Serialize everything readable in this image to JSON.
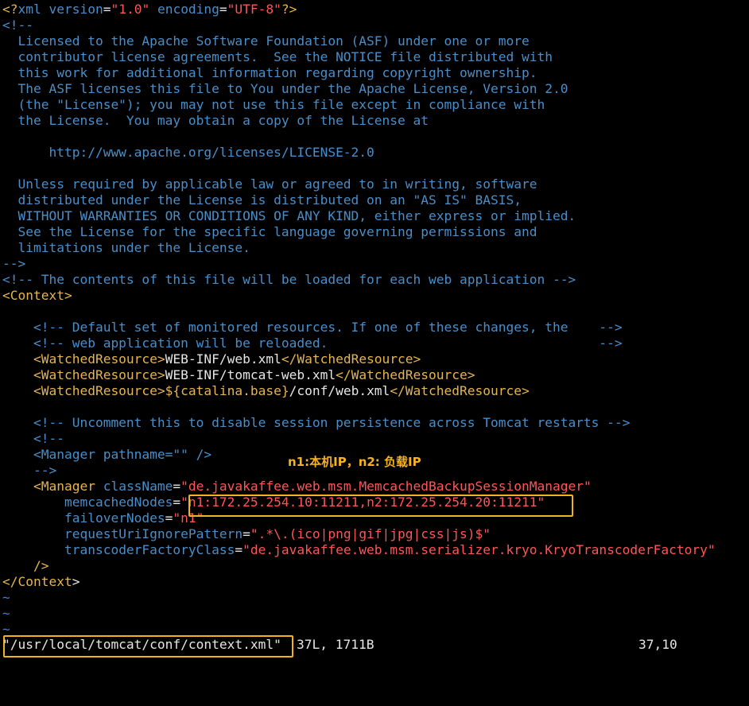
{
  "editor": {
    "lines": [
      {
        "segs": [
          [
            "tag",
            "<?"
          ],
          [
            "attr",
            "xml "
          ],
          [
            "attr",
            "version"
          ],
          [
            "text",
            "="
          ],
          [
            "str",
            "\"1.0\""
          ],
          [
            "text",
            " "
          ],
          [
            "attr",
            "encoding"
          ],
          [
            "text",
            "="
          ],
          [
            "str",
            "\"UTF-8\""
          ],
          [
            "tag",
            "?>"
          ]
        ]
      },
      {
        "segs": [
          [
            "comment",
            "<!--"
          ]
        ]
      },
      {
        "segs": [
          [
            "comment",
            "  Licensed to the Apache Software Foundation (ASF) under one or more"
          ]
        ]
      },
      {
        "segs": [
          [
            "comment",
            "  contributor license agreements.  See the NOTICE file distributed with"
          ]
        ]
      },
      {
        "segs": [
          [
            "comment",
            "  this work for additional information regarding copyright ownership."
          ]
        ]
      },
      {
        "segs": [
          [
            "comment",
            "  The ASF licenses this file to You under the Apache License, Version 2.0"
          ]
        ]
      },
      {
        "segs": [
          [
            "comment",
            "  (the \"License\"); you may not use this file except in compliance with"
          ]
        ]
      },
      {
        "segs": [
          [
            "comment",
            "  the License.  You may obtain a copy of the License at"
          ]
        ]
      },
      {
        "segs": [
          [
            "comment",
            ""
          ]
        ]
      },
      {
        "segs": [
          [
            "comment",
            "      http://www.apache.org/licenses/LICENSE-2.0"
          ]
        ]
      },
      {
        "segs": [
          [
            "comment",
            ""
          ]
        ]
      },
      {
        "segs": [
          [
            "comment",
            "  Unless required by applicable law or agreed to in writing, software"
          ]
        ]
      },
      {
        "segs": [
          [
            "comment",
            "  distributed under the License is distributed on an \"AS IS\" BASIS,"
          ]
        ]
      },
      {
        "segs": [
          [
            "comment",
            "  WITHOUT WARRANTIES OR CONDITIONS OF ANY KIND, either express or implied."
          ]
        ]
      },
      {
        "segs": [
          [
            "comment",
            "  See the License for the specific language governing permissions and"
          ]
        ]
      },
      {
        "segs": [
          [
            "comment",
            "  limitations under the License."
          ]
        ]
      },
      {
        "segs": [
          [
            "comment",
            "-->"
          ]
        ]
      },
      {
        "segs": [
          [
            "comment",
            "<!-- The contents of this file will be loaded for each web application -->"
          ]
        ]
      },
      {
        "segs": [
          [
            "tag",
            "<Context>"
          ]
        ]
      },
      {
        "segs": [
          [
            "text",
            ""
          ]
        ]
      },
      {
        "segs": [
          [
            "text",
            "    "
          ],
          [
            "comment",
            "<!-- Default set of monitored resources. If one of these changes, the    -->"
          ]
        ]
      },
      {
        "segs": [
          [
            "text",
            "    "
          ],
          [
            "comment",
            "<!-- web application will be reloaded.                                   -->"
          ]
        ]
      },
      {
        "segs": [
          [
            "text",
            "    "
          ],
          [
            "tag",
            "<WatchedResource>"
          ],
          [
            "text",
            "WEB-INF/web.xml"
          ],
          [
            "tag",
            "</WatchedResource>"
          ]
        ]
      },
      {
        "segs": [
          [
            "text",
            "    "
          ],
          [
            "tag",
            "<WatchedResource>"
          ],
          [
            "text",
            "WEB-INF/tomcat-web.xml"
          ],
          [
            "tag",
            "</WatchedResource>"
          ]
        ]
      },
      {
        "segs": [
          [
            "text",
            "    "
          ],
          [
            "tag",
            "<WatchedResource>"
          ],
          [
            "var",
            "${catalina.base}"
          ],
          [
            "text",
            "/conf/web.xml"
          ],
          [
            "tag",
            "</WatchedResource>"
          ]
        ]
      },
      {
        "segs": [
          [
            "text",
            ""
          ]
        ]
      },
      {
        "segs": [
          [
            "text",
            "    "
          ],
          [
            "comment",
            "<!-- Uncomment this to disable session persistence across Tomcat restarts -->"
          ]
        ]
      },
      {
        "segs": [
          [
            "text",
            "    "
          ],
          [
            "comment",
            "<!--"
          ]
        ]
      },
      {
        "segs": [
          [
            "text",
            "    "
          ],
          [
            "comment",
            "<Manager pathname=\"\" />"
          ]
        ]
      },
      {
        "segs": [
          [
            "text",
            "    "
          ],
          [
            "comment",
            "-->"
          ]
        ]
      },
      {
        "segs": [
          [
            "text",
            "    "
          ],
          [
            "tag",
            "<Manager "
          ],
          [
            "attr",
            "className"
          ],
          [
            "text",
            "="
          ],
          [
            "str",
            "\"de.javakaffee.web.msm.MemcachedBackupSessionManager\""
          ]
        ]
      },
      {
        "segs": [
          [
            "text",
            "        "
          ],
          [
            "attr",
            "memcachedNodes"
          ],
          [
            "text",
            "="
          ],
          [
            "str",
            "\"n1:172.25.254.10:11211,n2:172.25.254.20:11211\""
          ]
        ]
      },
      {
        "segs": [
          [
            "text",
            "        "
          ],
          [
            "attr",
            "failoverNodes"
          ],
          [
            "text",
            "="
          ],
          [
            "str",
            "\"n1\""
          ]
        ]
      },
      {
        "segs": [
          [
            "text",
            "        "
          ],
          [
            "attr",
            "requestUriIgnorePattern"
          ],
          [
            "text",
            "="
          ],
          [
            "str",
            "\".*\\.(ico|png|gif|jpg|css|js)$\""
          ]
        ]
      },
      {
        "segs": [
          [
            "text",
            "        "
          ],
          [
            "attr",
            "transcoderFactoryClass"
          ],
          [
            "text",
            "="
          ],
          [
            "str",
            "\"de.javakaffee.web.msm.serializer.kryo.KryoTranscoderFactory\""
          ]
        ]
      },
      {
        "segs": [
          [
            "text",
            "    "
          ],
          [
            "tag",
            "/>"
          ]
        ]
      },
      {
        "segs": [
          [
            "tag",
            "</Context"
          ],
          [
            "cursor",
            ">"
          ]
        ]
      },
      {
        "segs": [
          [
            "tilde",
            "~"
          ]
        ]
      },
      {
        "segs": [
          [
            "tilde",
            "~"
          ]
        ]
      },
      {
        "segs": [
          [
            "tilde",
            "~"
          ]
        ]
      }
    ]
  },
  "annotation": "n1:本机IP，n2: 负载IP",
  "status": {
    "file": "\"/usr/local/tomcat/conf/context.xml\"",
    "info": "37L, 1711B",
    "position": "37,10"
  }
}
